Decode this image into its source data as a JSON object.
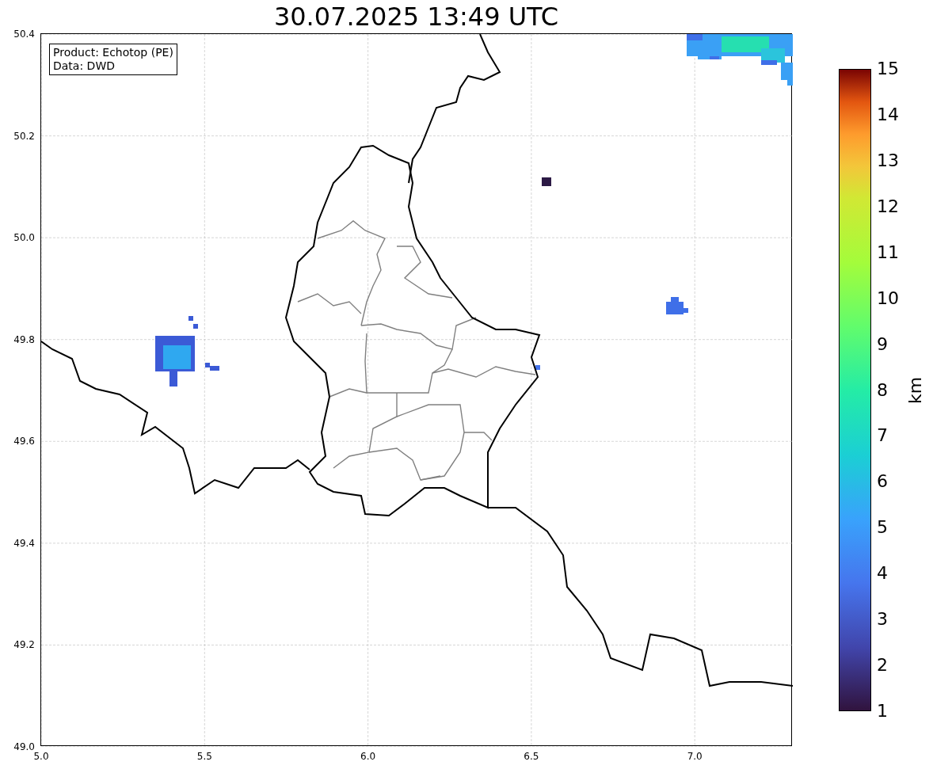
{
  "title": "30.07.2025 13:49 UTC",
  "map": {
    "info_lines": [
      "Product: Echotop (PE)",
      "Data: DWD"
    ],
    "xticks": [
      "5.0",
      "5.5",
      "6.0",
      "6.5",
      "7.0"
    ],
    "yticks": [
      "50.4",
      "50.2",
      "50.0",
      "49.8",
      "49.6",
      "49.4",
      "49.2",
      "49.0"
    ]
  },
  "colorbar": {
    "label": "km",
    "ticks": [
      "15",
      "14",
      "13",
      "12",
      "11",
      "10",
      "9",
      "8",
      "7",
      "6",
      "5",
      "4",
      "3",
      "2",
      "1"
    ]
  }
}
